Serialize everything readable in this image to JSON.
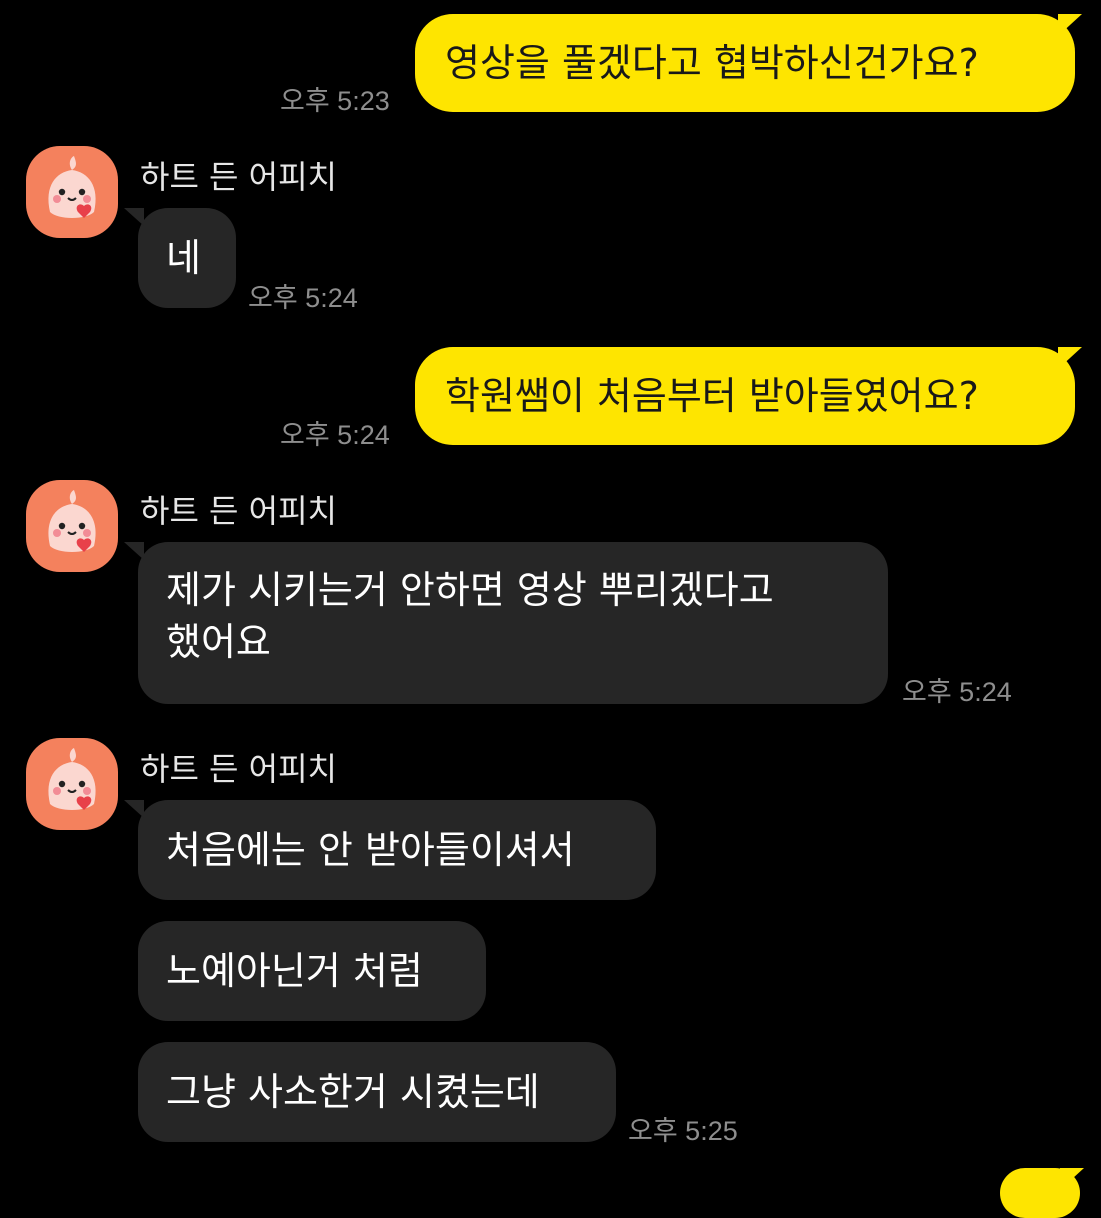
{
  "chat": {
    "sender_name": "하트 든 어피치",
    "msg1": {
      "text": "영상을 풀겠다고 협박하신건가요?",
      "time": "오후 5:23"
    },
    "msg2": {
      "text": "네",
      "time": "오후 5:24"
    },
    "msg3": {
      "text": "학원쌤이 처음부터 받아들였어요?",
      "time": "오후 5:24"
    },
    "msg4": {
      "line1": "제가 시키는거 안하면 영상 뿌리겠다고",
      "line2": "했어요",
      "time": "오후 5:24"
    },
    "msg5": {
      "text": "처음에는 안 받아들이셔서"
    },
    "msg6": {
      "text": "노예아닌거 처럼"
    },
    "msg7": {
      "text": "그냥 사소한거 시켰는데",
      "time": "오후 5:25"
    }
  },
  "colors": {
    "my_bubble": "#FEE500",
    "their_bubble": "#262626",
    "background": "#000000",
    "avatar": "#F4815D"
  },
  "icons": {
    "avatar": "apeach-avatar-icon"
  }
}
